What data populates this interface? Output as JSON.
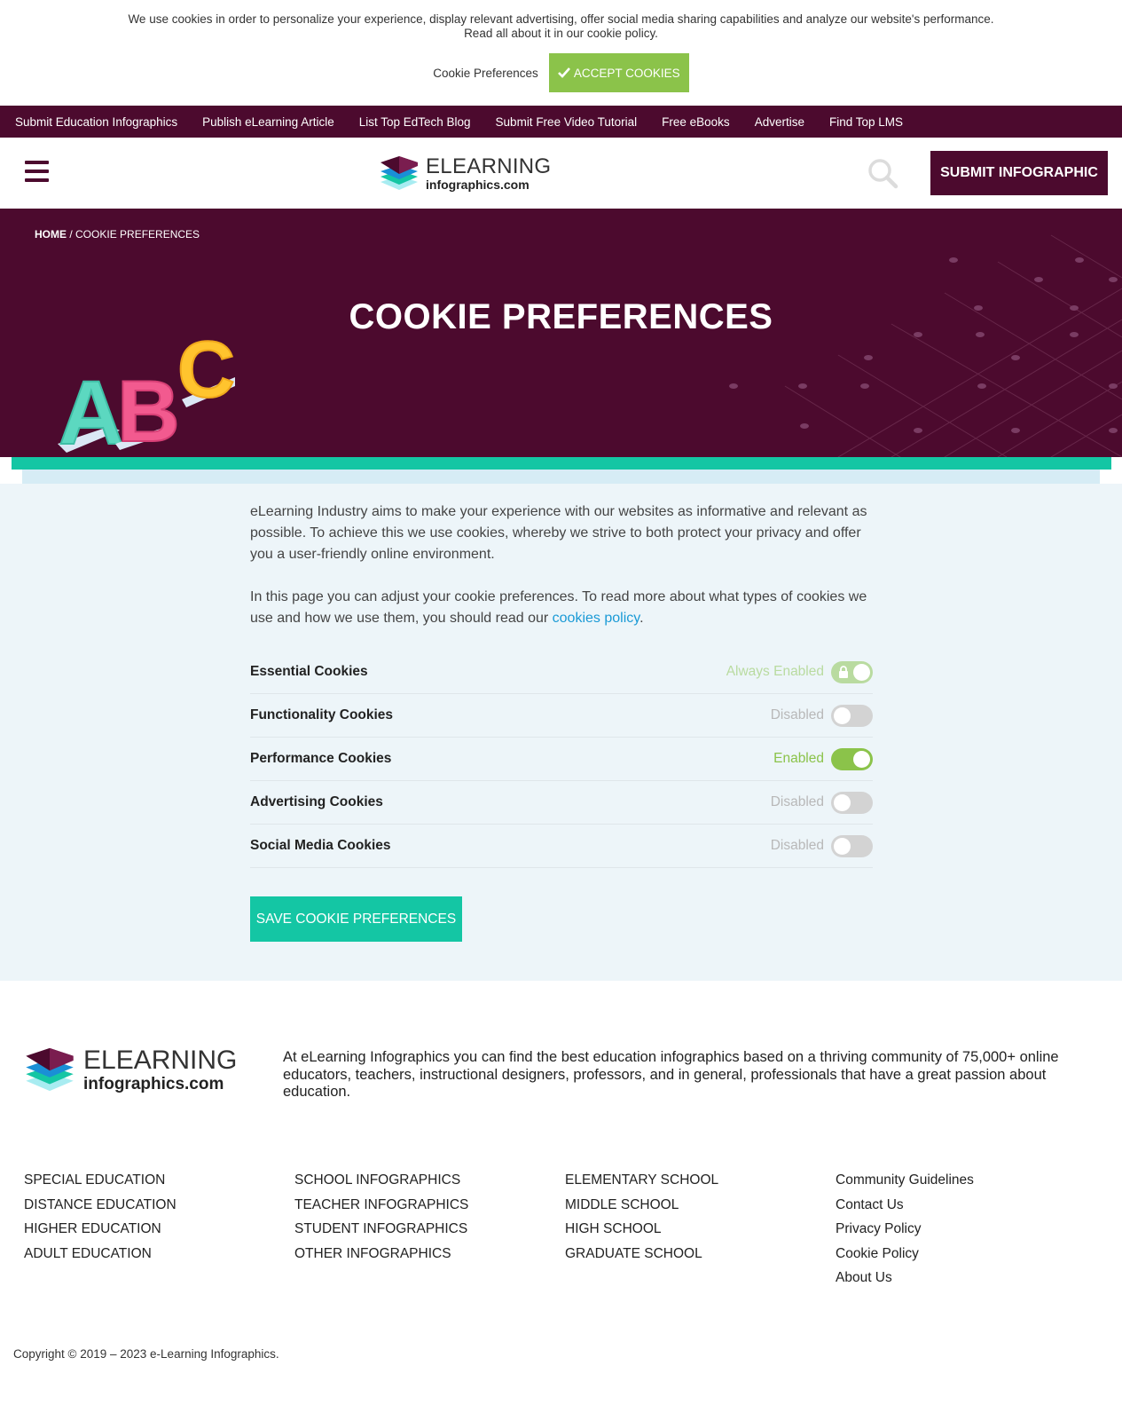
{
  "cookie_banner": {
    "message_line1": "We use cookies in order to personalize your experience, display relevant advertising, offer social media sharing capabilities and analyze our website's performance.",
    "message_line2": "Read all about it in our cookie policy.",
    "preferences_label": "Cookie Preferences",
    "accept_label": "ACCEPT COOKIES",
    "accept_icon": "check-icon",
    "accept_color": "#8bc34a"
  },
  "top_nav": {
    "items": [
      "Submit Education Infographics",
      "Publish eLearning Article",
      "List Top EdTech Blog",
      "Submit Free Video Tutorial",
      "Free eBooks",
      "Advertise",
      "Find Top LMS"
    ],
    "bg_color": "#4c0a2e"
  },
  "header": {
    "logo_big": "ELEARNING",
    "logo_small": "infographics.com",
    "menu_icon": "hamburger-icon",
    "search_icon": "search-icon",
    "submit_label": "SUBMIT INFOGRAPHIC"
  },
  "hero": {
    "breadcrumb_home": "HOME",
    "breadcrumb_sep": " / ",
    "breadcrumb_current": "COOKIE PREFERENCES",
    "title": "COOKIE PREFERENCES",
    "art_letters": [
      "A",
      "B",
      "C"
    ]
  },
  "content": {
    "intro": "eLearning Industry aims to make your experience with our websites as informative and relevant as possible. To achieve this we use cookies, whereby we strive to both protect your privacy and offer you a user-friendly online environment.",
    "adjust_text": "In this page you can adjust your cookie preferences. To read more about what types of cookies we use and how we use them, you should read our ",
    "policy_link": "cookies policy",
    "adjust_end": ".",
    "cookies": [
      {
        "name": "Essential Cookies",
        "state": "Always Enabled",
        "mode": "always"
      },
      {
        "name": "Functionality Cookies",
        "state": "Disabled",
        "mode": "off"
      },
      {
        "name": "Performance Cookies",
        "state": "Enabled",
        "mode": "on"
      },
      {
        "name": "Advertising Cookies",
        "state": "Disabled",
        "mode": "off"
      },
      {
        "name": "Social Media Cookies",
        "state": "Disabled",
        "mode": "off"
      }
    ],
    "save_label": "SAVE COOKIE PREFERENCES"
  },
  "footer": {
    "logo_big": "ELEARNING",
    "logo_small": "infographics.com",
    "about": "At eLearning Infographics you can find the best education infographics based on a thriving community of 75,000+ online educators, teachers, instructional designers, professors, and in general, professionals that have a great passion about education.",
    "columns": [
      [
        "SPECIAL EDUCATION",
        "DISTANCE EDUCATION",
        "HIGHER EDUCATION",
        "ADULT EDUCATION"
      ],
      [
        "SCHOOL INFOGRAPHICS",
        "TEACHER INFOGRAPHICS",
        "STUDENT INFOGRAPHICS",
        "OTHER INFOGRAPHICS"
      ],
      [
        "ELEMENTARY SCHOOL",
        "MIDDLE SCHOOL",
        "HIGH SCHOOL",
        "GRADUATE SCHOOL"
      ],
      [
        "Community Guidelines",
        "Contact Us",
        "Privacy Policy",
        "Cookie Policy",
        "About Us"
      ]
    ],
    "copyright": "Copyright © 2019 – 2023 e-Learning Infographics."
  }
}
